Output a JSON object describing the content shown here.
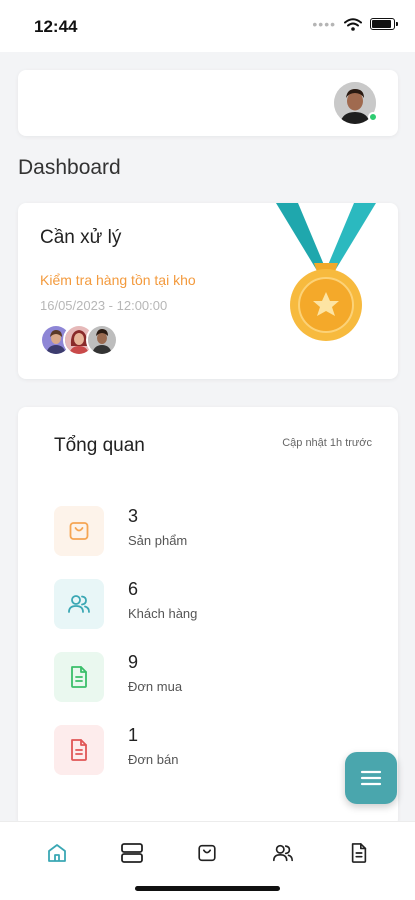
{
  "status_bar": {
    "time": "12:44",
    "battery_level": 0.9
  },
  "page": {
    "title": "Dashboard"
  },
  "pending": {
    "title": "Cần xử lý",
    "task": "Kiểm tra hàng tồn tại kho",
    "datetime": "16/05/2023 - 12:00:00",
    "assignee_count": 3
  },
  "overview": {
    "title": "Tổng quan",
    "updated": "Cập nhật 1h trước",
    "stats": [
      {
        "value": "3",
        "label": "Sản phẩm",
        "icon": "bag-icon",
        "color": "#f5a553",
        "bg": "#fdf3ea"
      },
      {
        "value": "6",
        "label": "Khách hàng",
        "icon": "users-icon",
        "color": "#3aa7b4",
        "bg": "#e8f6f7"
      },
      {
        "value": "9",
        "label": "Đơn mua",
        "icon": "document-icon",
        "color": "#3bbf6a",
        "bg": "#eaf8ef"
      },
      {
        "value": "1",
        "label": "Đơn bán",
        "icon": "document-icon",
        "color": "#e05656",
        "bg": "#fdecec"
      }
    ]
  },
  "bottom_nav": [
    {
      "name": "home",
      "icon": "home-icon",
      "active": true
    },
    {
      "name": "storage",
      "icon": "server-icon",
      "active": false
    },
    {
      "name": "products",
      "icon": "bag-icon",
      "active": false
    },
    {
      "name": "customers",
      "icon": "users-icon",
      "active": false
    },
    {
      "name": "orders",
      "icon": "document-icon",
      "active": false
    }
  ],
  "colors": {
    "accent": "#4aa6ad",
    "task": "#f39a3d",
    "online": "#2ecc71"
  }
}
